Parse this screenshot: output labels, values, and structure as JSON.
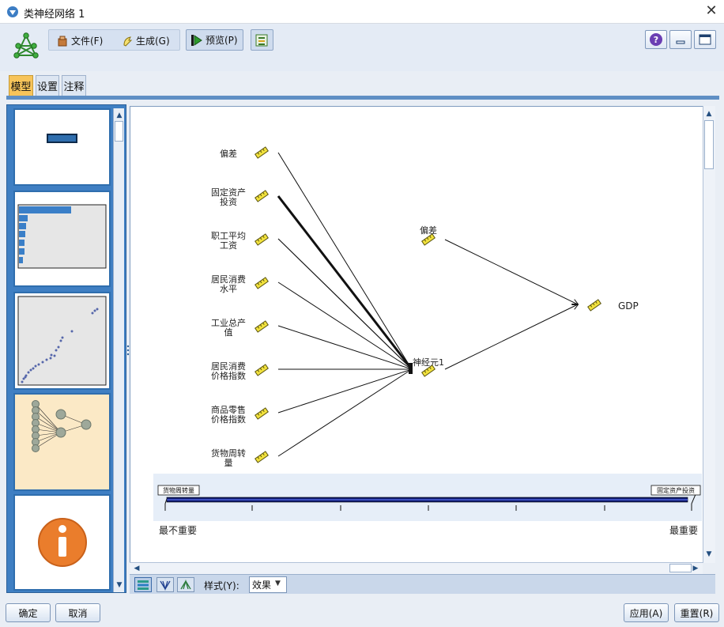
{
  "window": {
    "title": "类神经网络 1",
    "close_glyph": "✕"
  },
  "toolbar": {
    "file_label": "文件(F)",
    "generate_label": "生成(G)",
    "preview_label": "预览(P)"
  },
  "tabs": [
    {
      "label": "模型",
      "active": true
    },
    {
      "label": "设置",
      "active": false
    },
    {
      "label": "注释",
      "active": false
    }
  ],
  "diagram": {
    "input_nodes": [
      {
        "label_lines": [
          "偏差"
        ]
      },
      {
        "label_lines": [
          "固定资产",
          "投资"
        ]
      },
      {
        "label_lines": [
          "职工平均",
          "工资"
        ]
      },
      {
        "label_lines": [
          "居民消费",
          "水平"
        ]
      },
      {
        "label_lines": [
          "工业总产",
          "值"
        ]
      },
      {
        "label_lines": [
          "居民消费",
          "价格指数"
        ]
      },
      {
        "label_lines": [
          "商品零售",
          "价格指数"
        ]
      },
      {
        "label_lines": [
          "货物周转",
          "量"
        ]
      }
    ],
    "hidden_bias_label": "偏差",
    "hidden_neuron_label": "神经元1",
    "output_label": "GDP",
    "importance_left_tag": "货物周转量",
    "importance_right_tag": "固定资产投资",
    "importance_min_label": "最不重要",
    "importance_max_label": "最重要"
  },
  "bottom_toolbar": {
    "style_label": "样式(Y):",
    "style_value": "效果"
  },
  "buttons": {
    "ok": "确定",
    "cancel": "取消",
    "apply": "应用(A)",
    "reset": "重置(R)"
  },
  "colors": {
    "accent_blue": "#3f7fc3",
    "active_tab": "#f7c45a",
    "node_yellow": "#f2e23d",
    "info_orange": "#ea7d2c",
    "thumb_highlight": "#fbe9c6"
  },
  "icons": [
    "app-icon",
    "neural-network-icon",
    "file-icon",
    "generate-icon",
    "play-icon",
    "export-icon",
    "help-icon",
    "minimize-icon",
    "maximize-icon",
    "info-icon"
  ]
}
